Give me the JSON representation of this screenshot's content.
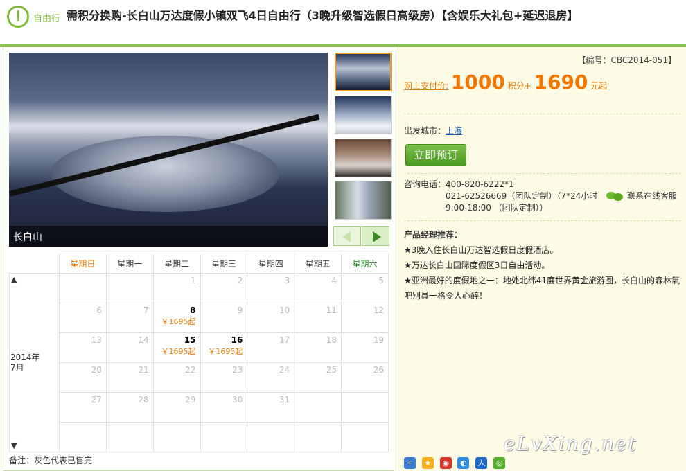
{
  "header": {
    "badge": "自由行",
    "title": "需积分换购-长白山万达度假小镇双飞4日自由行（3晚升级智选假日高级房）【含娱乐大礼包+延迟退房】"
  },
  "gallery": {
    "caption": "长白山"
  },
  "calendar": {
    "weekdays": [
      "星期日",
      "星期一",
      "星期二",
      "星期三",
      "星期四",
      "星期五",
      "星期六"
    ],
    "month_year": "2014年",
    "month": "7月",
    "up": "▲",
    "down": "▼",
    "rows": [
      [
        {
          "d": ""
        },
        {
          "d": ""
        },
        {
          "d": "1"
        },
        {
          "d": "2"
        },
        {
          "d": "3"
        },
        {
          "d": "4"
        },
        {
          "d": "5"
        }
      ],
      [
        {
          "d": "6"
        },
        {
          "d": "7"
        },
        {
          "d": "8",
          "price": "￥1695起"
        },
        {
          "d": "9"
        },
        {
          "d": "10"
        },
        {
          "d": "11"
        },
        {
          "d": "12"
        }
      ],
      [
        {
          "d": "13"
        },
        {
          "d": "14"
        },
        {
          "d": "15",
          "price": "￥1695起"
        },
        {
          "d": "16",
          "price": "￥1695起"
        },
        {
          "d": "17"
        },
        {
          "d": "18"
        },
        {
          "d": "19"
        }
      ],
      [
        {
          "d": "20"
        },
        {
          "d": "21"
        },
        {
          "d": "22"
        },
        {
          "d": "23"
        },
        {
          "d": "24"
        },
        {
          "d": "25"
        },
        {
          "d": "26"
        }
      ],
      [
        {
          "d": "27"
        },
        {
          "d": "28"
        },
        {
          "d": "29"
        },
        {
          "d": "30"
        },
        {
          "d": "31"
        },
        {
          "d": ""
        },
        {
          "d": ""
        }
      ],
      [
        {
          "d": ""
        },
        {
          "d": ""
        },
        {
          "d": ""
        },
        {
          "d": ""
        },
        {
          "d": ""
        },
        {
          "d": ""
        },
        {
          "d": ""
        }
      ]
    ],
    "note": "备注：灰色代表已售完"
  },
  "product": {
    "code": "【编号：CBC2014-051】",
    "price_label": "网上支付价:",
    "points": "1000",
    "points_unit": "积分+",
    "cash": "1690",
    "cash_unit": "元起",
    "departure_label": "出发城市：",
    "departure_city": "上海",
    "book_button": "立即预订",
    "phone_label": "咨询电话：",
    "phone_1": "400-820-6222*1",
    "phone_2": "021-62526669（团队定制）（7*24小时",
    "phone_3": "9:00-18:00 （团队定制））",
    "online_service": "联系在线客服",
    "rec_title": "产品经理推荐：",
    "rec_items": [
      "★3晚入住长白山万达智选假日度假酒店。",
      "★万达长白山国际度假区3日自由活动。",
      "★亚洲最好的度假地之一：地处北纬41度世界黄金旅游圈，长白山的森林氧吧别具一格令人心醉！"
    ],
    "watermark": "eLvXing.net"
  },
  "colors": {
    "brand_green": "#8cc152",
    "price_orange": "#f07800",
    "sunday": "#e07c0d",
    "saturday": "#2b8a2b"
  }
}
